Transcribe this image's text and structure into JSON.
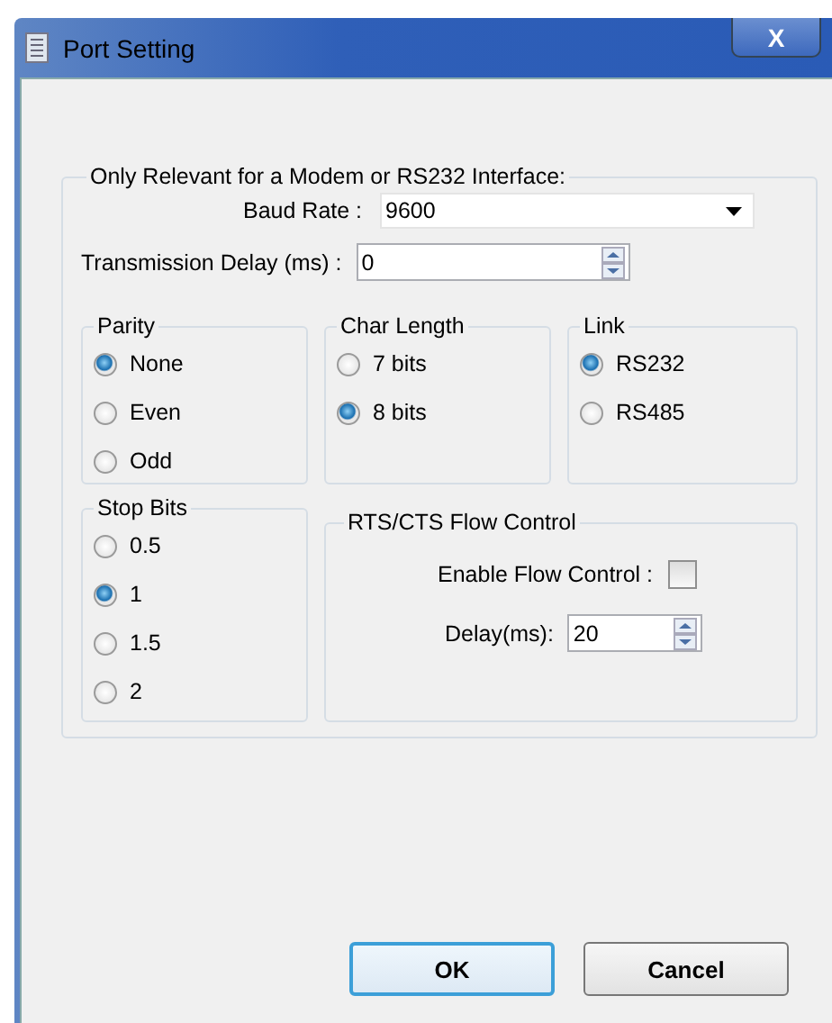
{
  "window": {
    "title": "Port Setting",
    "close": "X"
  },
  "interface_group": {
    "title": "Only Relevant for a Modem or RS232 Interface:"
  },
  "baud_rate": {
    "label": "Baud Rate :",
    "value": "9600"
  },
  "transmission_delay": {
    "label": "Transmission Delay (ms) :",
    "value": "0"
  },
  "groups": [
    {
      "title": "Parity",
      "options": [
        {
          "label": "None",
          "selected": true
        },
        {
          "label": "Even",
          "selected": false
        },
        {
          "label": "Odd",
          "selected": false
        }
      ]
    },
    {
      "title": "Char Length",
      "options": [
        {
          "label": "7 bits",
          "selected": false
        },
        {
          "label": "8 bits",
          "selected": true
        }
      ]
    },
    {
      "title": "Link",
      "options": [
        {
          "label": "RS232",
          "selected": true
        },
        {
          "label": "RS485",
          "selected": false
        }
      ]
    }
  ],
  "stop_bits": {
    "title": "Stop Bits",
    "options": [
      {
        "label": "0.5",
        "selected": false
      },
      {
        "label": "1",
        "selected": true
      },
      {
        "label": "1.5",
        "selected": false
      },
      {
        "label": "2",
        "selected": false
      }
    ]
  },
  "flow_control": {
    "title": "RTS/CTS Flow Control",
    "enable_label": "Enable Flow Control :",
    "checked": false,
    "delay_label": "Delay(ms):",
    "delay_value": "20"
  },
  "buttons": [
    {
      "label": "OK",
      "selected": true
    },
    {
      "label": "Cancel",
      "selected": false
    }
  ]
}
